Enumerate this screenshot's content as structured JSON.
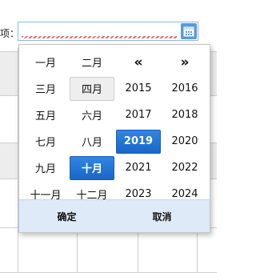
{
  "field": {
    "label": "项："
  },
  "icons": {
    "calendar": "calendar-icon"
  },
  "picker": {
    "rows": [
      [
        {
          "text": "一月",
          "state": ""
        },
        {
          "text": "二月",
          "state": ""
        },
        {
          "text": "«",
          "state": "nav"
        },
        {
          "text": "»",
          "state": "nav"
        }
      ],
      [
        {
          "text": "三月",
          "state": ""
        },
        {
          "text": "四月",
          "state": "hover"
        },
        {
          "text": "2015",
          "state": ""
        },
        {
          "text": "2016",
          "state": ""
        }
      ],
      [
        {
          "text": "五月",
          "state": ""
        },
        {
          "text": "六月",
          "state": ""
        },
        {
          "text": "2017",
          "state": ""
        },
        {
          "text": "2018",
          "state": ""
        }
      ],
      [
        {
          "text": "七月",
          "state": ""
        },
        {
          "text": "八月",
          "state": ""
        },
        {
          "text": "2019",
          "state": "selected"
        },
        {
          "text": "2020",
          "state": ""
        }
      ],
      [
        {
          "text": "九月",
          "state": ""
        },
        {
          "text": "十月",
          "state": "selected"
        },
        {
          "text": "2021",
          "state": ""
        },
        {
          "text": "2022",
          "state": ""
        }
      ],
      [
        {
          "text": "十一月",
          "state": ""
        },
        {
          "text": "十二月",
          "state": ""
        },
        {
          "text": "2023",
          "state": ""
        },
        {
          "text": "2024",
          "state": ""
        }
      ]
    ],
    "selected_month": "十月",
    "selected_year": "2019",
    "confirm_label": "确定",
    "cancel_label": "取消"
  },
  "colors": {
    "selected": "#1a6fd4",
    "footer": "#deeaf7"
  }
}
